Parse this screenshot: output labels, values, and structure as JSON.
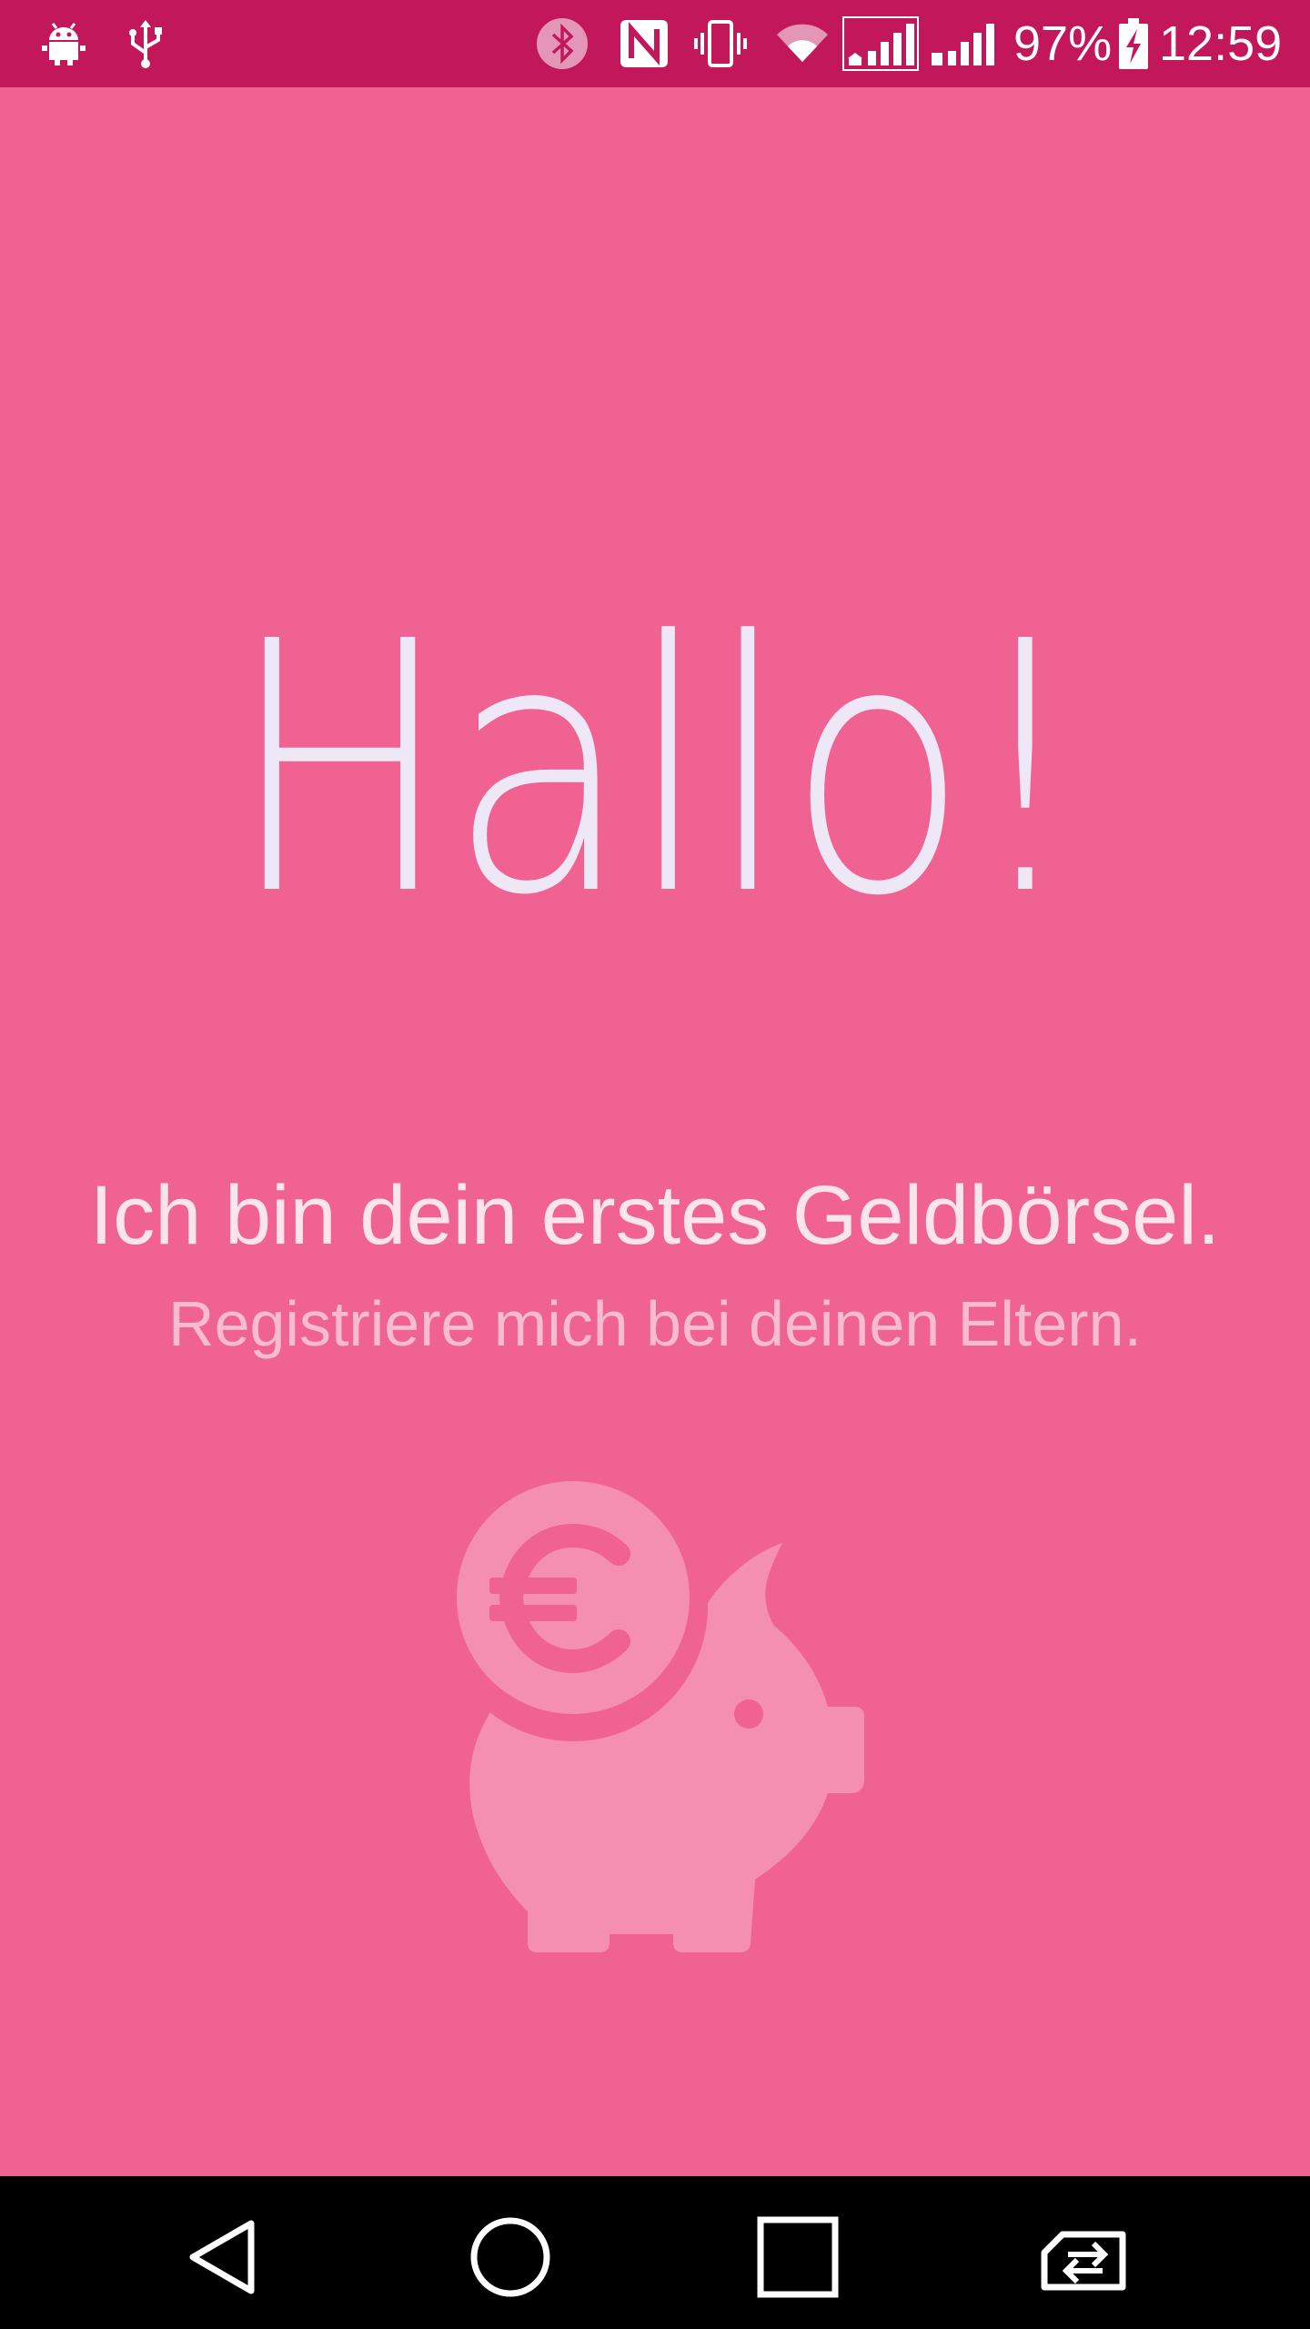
{
  "status_bar": {
    "battery_percent": "97%",
    "time": "12:59",
    "icons": [
      "android-debug-icon",
      "usb-icon",
      "bluetooth-icon",
      "nfc-icon",
      "vibrate-icon",
      "wifi-icon",
      "signal-sim1-icon",
      "signal-sim2-icon",
      "battery-charging-icon"
    ]
  },
  "main": {
    "greeting": "Hallo!",
    "tagline": "Ich bin dein erstes Geldbörsel.",
    "subline": "Registriere mich bei deinen Eltern.",
    "illustration": "piggy-bank-euro-icon"
  },
  "nav_bar": {
    "buttons": [
      "back-icon",
      "home-icon",
      "recents-icon",
      "switch-sim-icon"
    ]
  },
  "colors": {
    "background": "#f06292",
    "status_bar": "#c2185b",
    "nav_bar": "#000000",
    "greeting_text": "#ede7f6",
    "tagline_text": "#fce4ec",
    "subline_text": "#f8bbd0",
    "illustration": "#f48fb1"
  }
}
